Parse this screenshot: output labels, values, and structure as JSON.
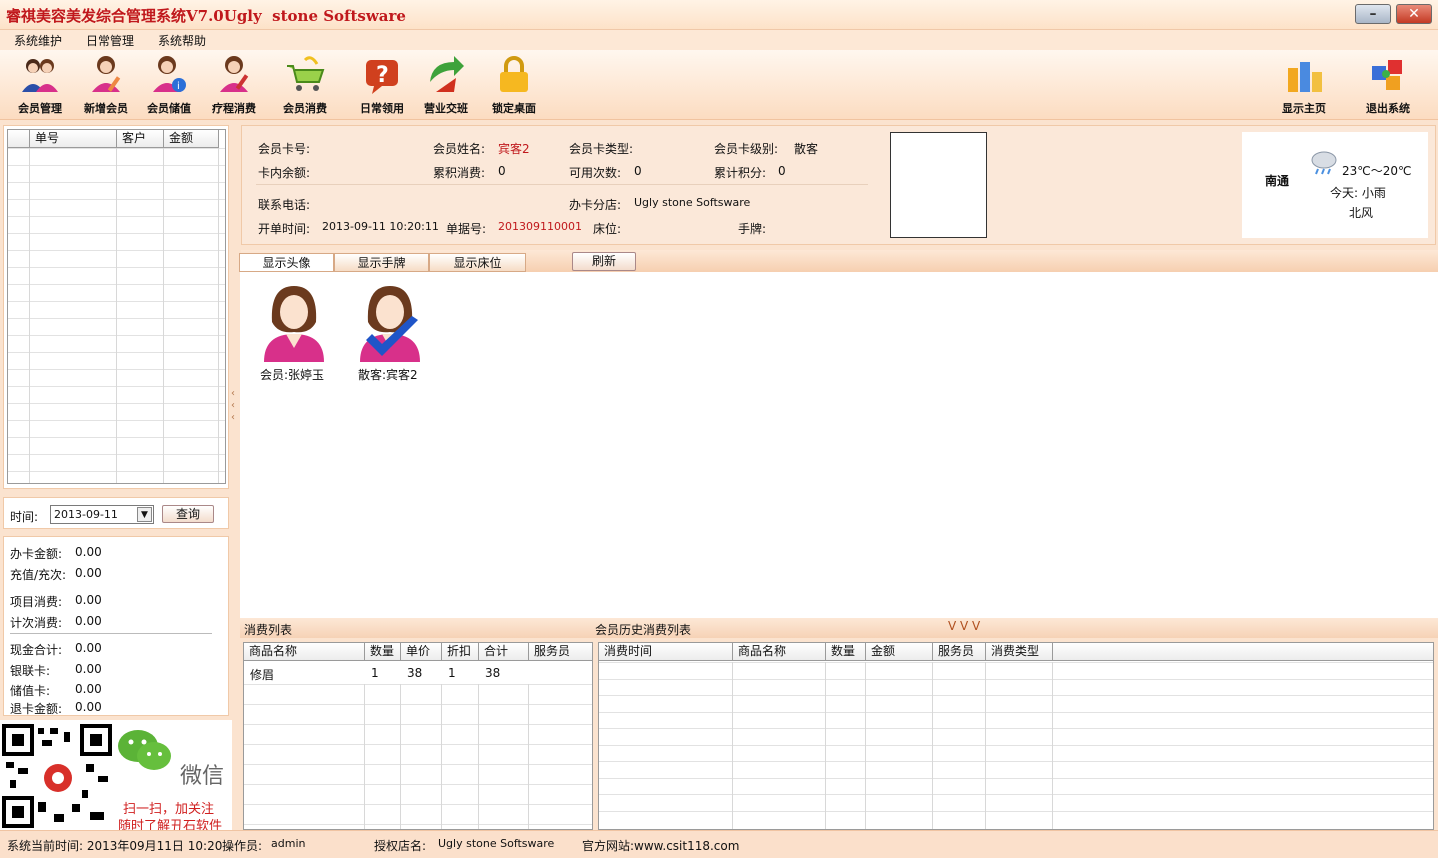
{
  "window": {
    "title": "睿祺美容美发综合管理系统V7.0Ugly  stone Softsware",
    "minimize": "–",
    "close": "✕"
  },
  "menu": [
    "系统维护",
    "日常管理",
    "系统帮助"
  ],
  "toolbar": {
    "items": [
      {
        "label": "会员管理",
        "icon": "members-icon"
      },
      {
        "label": "新增会员",
        "icon": "add-member-icon"
      },
      {
        "label": "会员储值",
        "icon": "member-deposit-icon"
      },
      {
        "label": "疗程消费",
        "icon": "treatment-icon"
      },
      {
        "label": "会员消费",
        "icon": "shopping-cart-icon"
      },
      {
        "label": "日常领用",
        "icon": "question-icon"
      },
      {
        "label": "营业交班",
        "icon": "shift-handover-icon"
      },
      {
        "label": "锁定桌面",
        "icon": "lock-icon"
      }
    ],
    "right": [
      {
        "label": "显示主页",
        "icon": "home-buildings-icon"
      },
      {
        "label": "退出系统",
        "icon": "exit-puzzle-icon"
      }
    ]
  },
  "order_list": {
    "headers": [
      "单号",
      "客户",
      "金额"
    ]
  },
  "query": {
    "time_label": "时间:",
    "date_value": "2013-09-11",
    "button": "查询"
  },
  "summary": [
    {
      "label": "办卡金额:",
      "value": "0.00"
    },
    {
      "label": "充值/充次:",
      "value": "0.00"
    },
    {
      "label": "项目消费:",
      "value": "0.00"
    },
    {
      "label": "计次消费:",
      "value": "0.00"
    },
    {
      "label": "现金合计:",
      "value": "0.00"
    },
    {
      "label": "银联卡:",
      "value": "0.00"
    },
    {
      "label": "储值卡:",
      "value": "0.00"
    },
    {
      "label": "退卡金额:",
      "value": "0.00"
    }
  ],
  "promo": {
    "wechat": "微信",
    "line1": "扫一扫，加关注",
    "line2": "随时了解丑石软件"
  },
  "member_info": {
    "card_no_label": "会员卡号:",
    "name_label": "会员姓名:",
    "name_value": "宾客2",
    "card_type_label": "会员卡类型:",
    "card_level_label": "会员卡级别:",
    "card_level_value": "散客",
    "balance_label": "卡内余额:",
    "total_consume_label": "累积消费:",
    "total_consume_value": "0",
    "usable_times_label": "可用次数:",
    "usable_times_value": "0",
    "points_label": "累计积分:",
    "points_value": "0",
    "phone_label": "联系电话:",
    "branch_label": "办卡分店:",
    "branch_value": "Ugly  stone Softsware",
    "open_time_label": "开单时间:",
    "open_time_value": "2013-09-11 10:20:11",
    "bill_no_label": "单据号:",
    "bill_no_value": "201309110001",
    "bed_label": "床位:",
    "wristband_label": "手牌:"
  },
  "weather": {
    "city": "南通",
    "temp": "23℃～20℃",
    "today": "今天: 小雨",
    "wind": "北风"
  },
  "tabs": [
    "显示头像",
    "显示手牌",
    "显示床位"
  ],
  "refresh": "刷新",
  "customers": [
    {
      "label": "会员:张婷玉",
      "checked": false
    },
    {
      "label": "散客:宾客2",
      "checked": true
    }
  ],
  "consume": {
    "title": "消费列表",
    "headers": [
      "商品名称",
      "数量",
      "单价",
      "折扣",
      "合计",
      "服务员"
    ],
    "rows": [
      [
        "修眉",
        "1",
        "38",
        "1",
        "38",
        ""
      ]
    ]
  },
  "history": {
    "title": "会员历史消费列表",
    "arrows": "V V V",
    "headers": [
      "消费时间",
      "商品名称",
      "数量",
      "金额",
      "服务员",
      "消费类型"
    ]
  },
  "status": {
    "time": "系统当前时间: 2013年09月11日 10:20",
    "operator_label": "操作员:",
    "operator": "admin",
    "shop_label": "授权店名:",
    "shop": "Ugly  stone Softsware",
    "site": "官方网站:www.csit118.com"
  },
  "colors": {
    "title_red": "#c0181c",
    "accent_peach": "#fbe3cf",
    "avatar_pink": "#d8308a",
    "check_blue": "#1f55c8"
  }
}
